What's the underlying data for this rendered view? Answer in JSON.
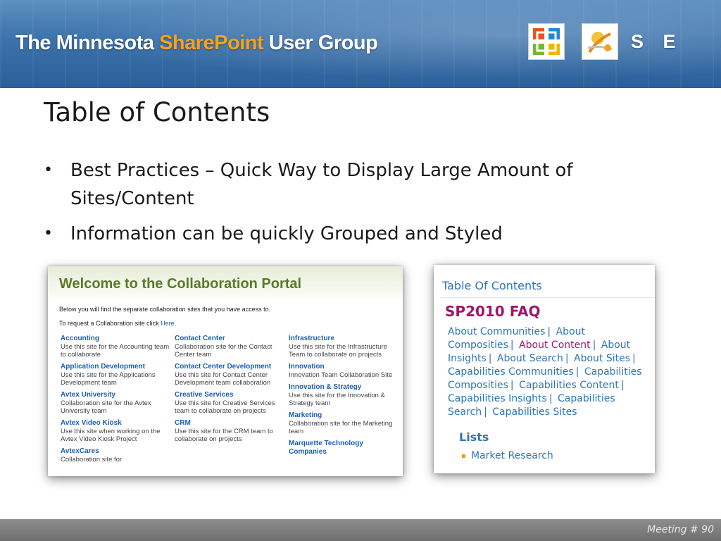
{
  "header": {
    "brand_prefix": "The Minnesota ",
    "brand_accent": "SharePoint",
    "brand_suffix": " User Group",
    "se_text": "S E",
    "accent_color": "#f7a21b"
  },
  "slide": {
    "title": "Table of Contents",
    "bullets": [
      "Best Practices – Quick Way to Display Large Amount of Sites/Content",
      "Information can be quickly Grouped and Styled"
    ],
    "bullet_glyph": "•"
  },
  "portal": {
    "title": "Welcome to the Collaboration Portal",
    "intro": "Below you will find the separate collaboration sites that you have access to.",
    "request_prefix": "To request a Collaboration site click ",
    "request_link": "Here.",
    "columns": [
      [
        {
          "name": "Accounting",
          "desc": "Use this site for the Accounting team to collaborate"
        },
        {
          "name": "Application Development",
          "desc": "Use this site for the Applications Development team"
        },
        {
          "name": "Avtex University",
          "desc": "Collaboration site for the Avtex University team"
        },
        {
          "name": "Avtex Video Kiosk",
          "desc": "Use this site when working on the Avtex Video Kiosk Project"
        },
        {
          "name": "AvtexCares",
          "desc": "Collaboration site for"
        }
      ],
      [
        {
          "name": "Contact Center",
          "desc": "Collaboration site for the Contact Center team"
        },
        {
          "name": "Contact Center Development",
          "desc": "Use this site for Contact Center Development team collaboration"
        },
        {
          "name": "Creative Services",
          "desc": "Use this site for Creative Services team to collaborate on projects"
        },
        {
          "name": "CRM",
          "desc": "Use this site for the CRM team to collaborate on projects"
        }
      ],
      [
        {
          "name": "Infrastructure",
          "desc": "Use this site for the Infrastructure Team to collaborate on projects"
        },
        {
          "name": "Innovation",
          "desc": "Innovation Team Collaboration Site"
        },
        {
          "name": "Innovation & Strategy",
          "desc": "Use this site for the Innovation & Strategy team"
        },
        {
          "name": "Marketing",
          "desc": "Collaboration site for the Marketing team"
        },
        {
          "name": "Marquette Technology Companies",
          "desc": ""
        }
      ]
    ]
  },
  "toc": {
    "title": "Table Of Contents",
    "faq_title": "SP2010 FAQ",
    "links": [
      "About Communities",
      "About Composities",
      "About Content",
      "About Insights",
      "About Search",
      "About Sites",
      "Capabilities Communities",
      "Capabilities Composities",
      "Capabilities Content",
      "Capabilities Insights",
      "Capabilities Search",
      "Capabilities Sites"
    ],
    "highlighted_link": "About Content",
    "separator": "|",
    "lists_heading": "Lists",
    "list_items": [
      "Market Research"
    ]
  },
  "footer": {
    "meeting": "Meeting # 90"
  }
}
